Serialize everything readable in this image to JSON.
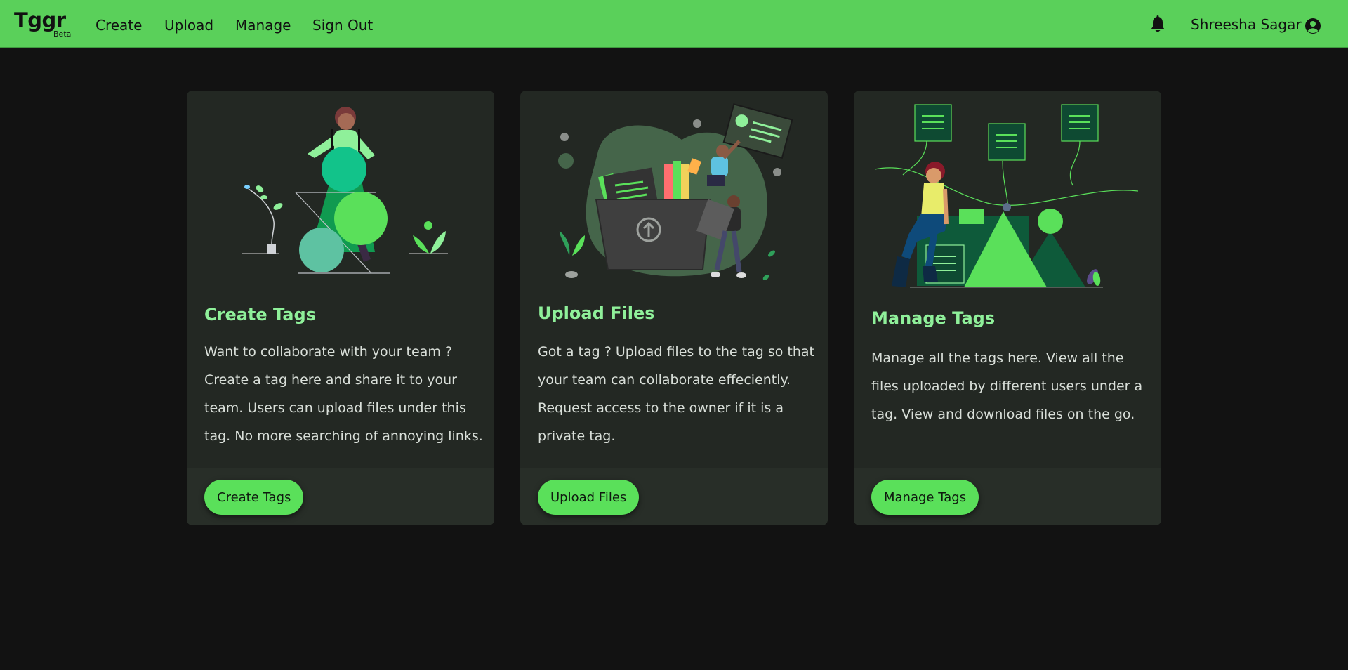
{
  "navbar": {
    "brand": "Tggr",
    "brand_tag": "Beta",
    "links": [
      "Create",
      "Upload",
      "Manage",
      "Sign Out"
    ],
    "user_name": "Shreesha Sagar",
    "notification_icon": "bell-icon",
    "account_icon": "user-circle-icon",
    "color": "#5ad05a"
  },
  "cards": [
    {
      "title": "Create Tags",
      "description": "Want to collaborate with your team ? Create a tag here and share it to your team. Users can upload files under this tag. No more searching of annoying links.",
      "button": "Create Tags",
      "illustration": "woman-with-shapes-illustration"
    },
    {
      "title": "Upload Files",
      "description": "Got a tag ? Upload files to the tag so that your team can collaborate effeciently. Request access to the owner if it is a private tag.",
      "button": "Upload Files",
      "illustration": "upload-folder-illustration"
    },
    {
      "title": "Manage Tags",
      "description": "Manage all the tags here. View all the files uploaded by different users under a tag. View and download files on the go.",
      "button": "Manage Tags",
      "illustration": "woman-sitting-network-illustration"
    }
  ],
  "theme": {
    "background": "#121212",
    "card": "#232823",
    "accent": "#5ae05a",
    "title_color": "#8ff09a"
  }
}
